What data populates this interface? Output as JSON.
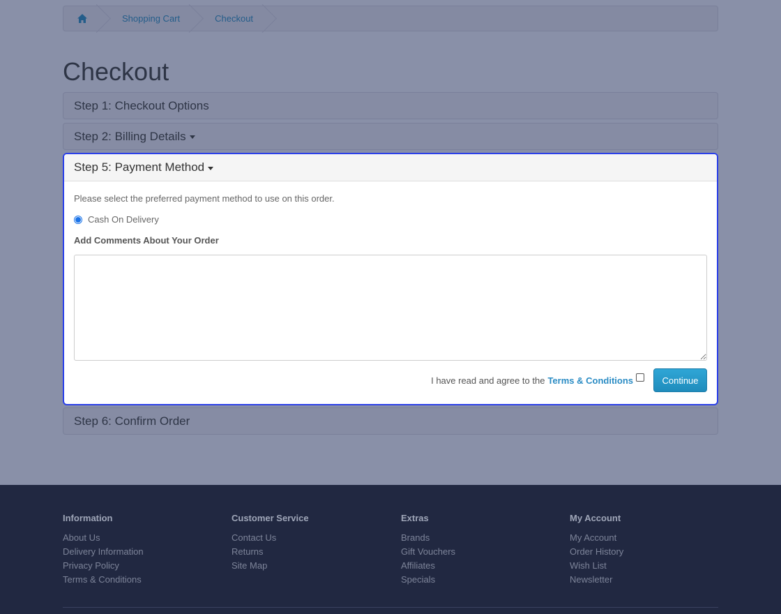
{
  "breadcrumb": {
    "home_icon": "home-icon",
    "items": [
      "Shopping Cart",
      "Checkout"
    ]
  },
  "page_title": "Checkout",
  "steps": {
    "step1": "Step 1: Checkout Options",
    "step2": "Step 2: Billing Details",
    "step5": "Step 5: Payment Method",
    "step6": "Step 6: Confirm Order"
  },
  "payment": {
    "instruction": "Please select the preferred payment method to use on this order.",
    "method_label": "Cash On Delivery",
    "method_selected": true,
    "comments_label": "Add Comments About Your Order",
    "comments_value": "",
    "agree_text": "I have read and agree to the",
    "terms_link": "Terms & Conditions",
    "agree_checked": false,
    "continue_label": "Continue"
  },
  "footer": {
    "columns": [
      {
        "title": "Information",
        "links": [
          "About Us",
          "Delivery Information",
          "Privacy Policy",
          "Terms & Conditions"
        ]
      },
      {
        "title": "Customer Service",
        "links": [
          "Contact Us",
          "Returns",
          "Site Map"
        ]
      },
      {
        "title": "Extras",
        "links": [
          "Brands",
          "Gift Vouchers",
          "Affiliates",
          "Specials"
        ]
      },
      {
        "title": "My Account",
        "links": [
          "My Account",
          "Order History",
          "Wish List",
          "Newsletter"
        ]
      }
    ]
  },
  "colors": {
    "accent": "#2b40e8",
    "link": "#2b8cc4",
    "button": "#1f8cbc",
    "footer_bg": "#212841"
  }
}
